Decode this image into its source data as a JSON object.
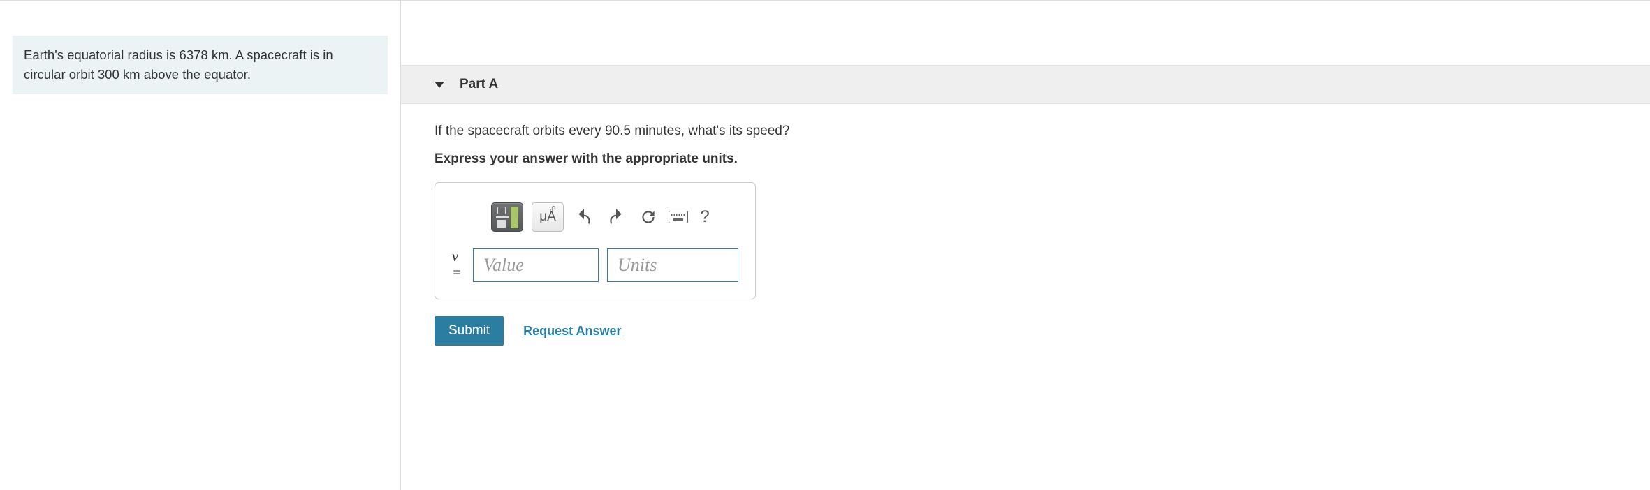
{
  "problem": {
    "statement": "Earth's equatorial radius is 6378 km. A spacecraft is in circular orbit 300 km above the equator."
  },
  "part": {
    "title": "Part A",
    "question": "If the spacecraft orbits every 90.5 minutes, what's its speed?",
    "instruction": "Express your answer with the appropriate units."
  },
  "answer": {
    "variable": "v =",
    "value_placeholder": "Value",
    "units_placeholder": "Units"
  },
  "toolbar": {
    "units_label": "μÅ",
    "help_label": "?"
  },
  "actions": {
    "submit": "Submit",
    "request": "Request Answer"
  }
}
